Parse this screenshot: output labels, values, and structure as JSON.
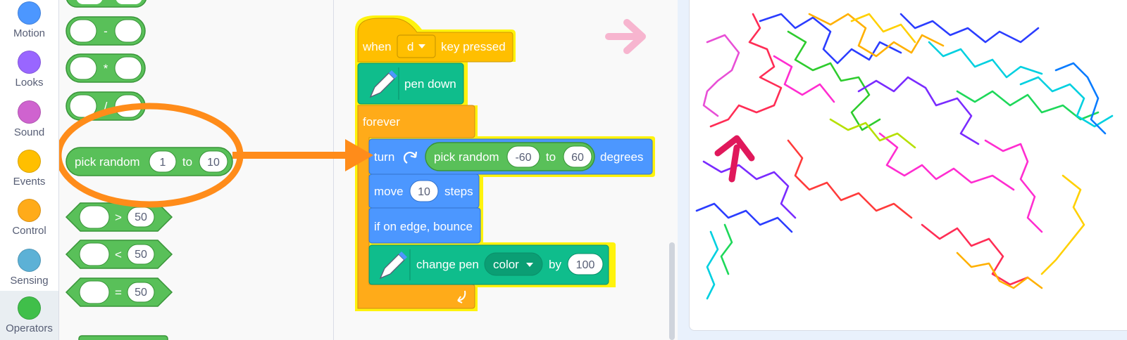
{
  "categories": [
    {
      "label": "Motion",
      "color": "#4c97ff"
    },
    {
      "label": "Looks",
      "color": "#9966ff"
    },
    {
      "label": "Sound",
      "color": "#cf63cf"
    },
    {
      "label": "Events",
      "color": "#ffbf00"
    },
    {
      "label": "Control",
      "color": "#ffab19"
    },
    {
      "label": "Sensing",
      "color": "#5cb1d6"
    },
    {
      "label": "Operators",
      "color": "#40bf4a"
    }
  ],
  "palette": {
    "minus_op": "-",
    "times_op": "*",
    "divide_op": "/",
    "pick_random_label": "pick random",
    "pick_random_from": "1",
    "pick_random_to_label": "to",
    "pick_random_to": "10",
    "gt_op": ">",
    "gt_value": "50",
    "lt_op": "<",
    "lt_value": "50",
    "eq_op": "=",
    "eq_value": "50"
  },
  "script": {
    "hat_when": "when",
    "hat_key": "d",
    "hat_pressed": "key pressed",
    "pen_down": "pen down",
    "forever": "forever",
    "turn": "turn",
    "turn_pick_random": "pick random",
    "turn_from": "-60",
    "turn_to_label": "to",
    "turn_to": "60",
    "degrees": "degrees",
    "move": "move",
    "move_value": "10",
    "steps": "steps",
    "bounce": "if on edge, bounce",
    "change_pen": "change pen",
    "pen_param": "color",
    "by": "by",
    "change_value": "100"
  },
  "colors": {
    "operators": "#59c059",
    "operators_dark": "#389438",
    "events": "#ffbf00",
    "control": "#ffab19",
    "motion": "#4c97ff",
    "pen": "#0fbd8c",
    "highlight": "#fff200",
    "annotation_orange": "#ff8c1a",
    "annotation_pink": "#f7b5cf"
  }
}
